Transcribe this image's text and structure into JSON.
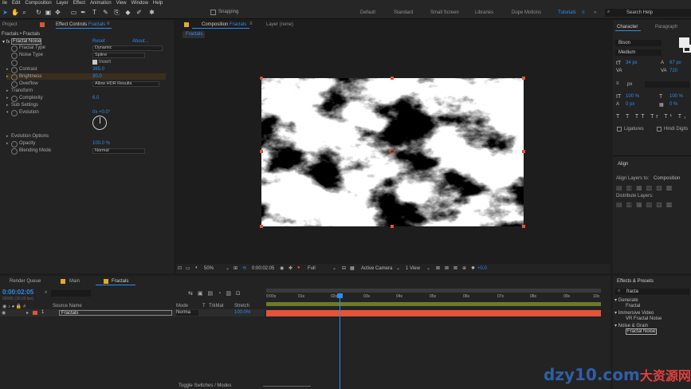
{
  "menu": [
    "ile",
    "Edit",
    "Composition",
    "Layer",
    "Effect",
    "Animation",
    "View",
    "Window",
    "Help"
  ],
  "toolbar": {
    "snapping": "Snapping",
    "workspaces": [
      "Default",
      "Standard",
      "Small Screen",
      "Libraries",
      "Dope Motions",
      "Tutorials"
    ],
    "search": "Search Help"
  },
  "project_tab": "Project",
  "effects_tab": "Effect Controls",
  "effects_target": "Fractals",
  "breadcrumb": "Fractals • Fractals",
  "fx": {
    "name": "Fractal Noise",
    "reset": "Reset",
    "about": "About...",
    "fractal_type_label": "Fractal Type",
    "fractal_type": "Dynamic",
    "noise_type_label": "Noise Type",
    "noise_type": "Spline",
    "invert": "Invert",
    "contrast_label": "Contrast",
    "contrast": "365.0",
    "brightness_label": "Brightness",
    "brightness": "30.0",
    "overflow_label": "Overflow",
    "overflow": "Allow HDR Results",
    "transform": "Transform",
    "complexity_label": "Complexity",
    "complexity": "6.0",
    "subsettings": "Sub Settings",
    "evolution_label": "Evolution",
    "evolution": "0x +0.0°",
    "evo_options": "Evolution Options",
    "opacity_label": "Opacity",
    "opacity": "100.0 %",
    "blending_label": "Blending Mode",
    "blending": "Normal"
  },
  "comp": {
    "tab": "Composition",
    "name": "Fractals",
    "layer_tab": "Layer (none)",
    "crumb": "Fractals",
    "zoom": "50%",
    "time": "0:00:02:05",
    "res": "Full",
    "camera": "Active Camera",
    "view": "1 View",
    "exposure": "+0.0"
  },
  "right": {
    "character": "Character",
    "paragraph": "Paragraph",
    "font": "Bison",
    "style": "Medium",
    "size": "34 px",
    "leading": "67 px",
    "kern": "720",
    "tracking": "0",
    "v1": "px",
    "scale_v": "100 %",
    "scale_h": "100 %",
    "baseline": "0 px",
    "tsume": "0 %",
    "ligatures": "Ligatures",
    "hindi": "Hindi Digits",
    "align": "Align",
    "align_to_label": "Align Layers to:",
    "align_to": "Composition",
    "distribute": "Distribute Layers:",
    "fxp": "Effects & Presets",
    "search": "fracta",
    "tree": [
      {
        "t": "▾ Generate",
        "l": 0
      },
      {
        "t": "Fractal",
        "l": 2
      },
      {
        "t": "▾ Immersive Video",
        "l": 0
      },
      {
        "t": "VR Fractal Noise",
        "l": 2
      },
      {
        "t": "▾ Noise & Grain",
        "l": 0
      },
      {
        "t": "Fractal Noise",
        "l": 2
      }
    ]
  },
  "timeline": {
    "tabs": [
      "Render Queue",
      "Main",
      "Fractals"
    ],
    "time": "0:00:02:05",
    "fps": "00065 (30.00 fps)",
    "cols": {
      "name": "Source Name",
      "mode": "Mode",
      "t": "T",
      "trk": "TrkMat",
      "stretch": "Stretch"
    },
    "layer": {
      "num": "1",
      "name": "Fractals",
      "mode": "Norma",
      "stretch": "100.0%"
    },
    "ticks": [
      "0:00s",
      "01s",
      "02s",
      "03s",
      "04s",
      "05s",
      "06s",
      "07s",
      "08s",
      "09s",
      "10s"
    ],
    "toggle": "Toggle Switches / Modes"
  },
  "watermark": "dzy10.com",
  "watermark_cn": "大资源网"
}
